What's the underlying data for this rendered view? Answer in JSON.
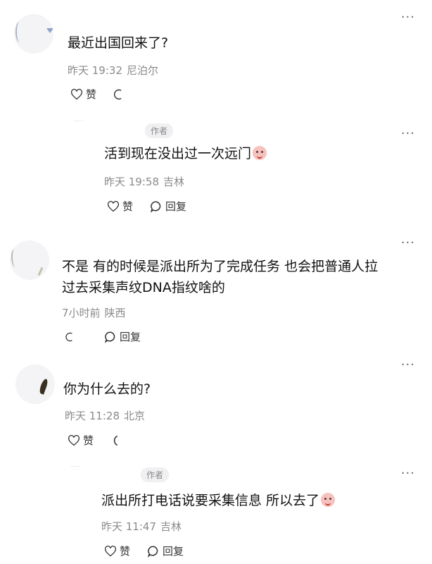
{
  "comments": [
    {
      "text": "最近出国回来了?",
      "time": "昨天 19:32",
      "location": "尼泊尔",
      "like_label": "赞",
      "more": "···",
      "replies": [
        {
          "author_badge": "作者",
          "text": "活到现在没出过一次远门",
          "time": "昨天 19:58",
          "location": "吉林",
          "like_label": "赞",
          "reply_label": "回复",
          "more": "···"
        }
      ]
    },
    {
      "text_line1": "不是 有的时候是派出所为了完成任务 也会把普通人拉",
      "text_line2": "过去采集声纹DNA指纹啥的",
      "time": "7小时前",
      "location": "陕西",
      "reply_label": "回复",
      "more": "···"
    },
    {
      "text": "你为什么去的?",
      "time": "昨天 11:28",
      "location": "北京",
      "like_label": "赞",
      "more": "···",
      "replies": [
        {
          "author_badge": "作者",
          "text": "派出所打电话说要采集信息 所以去了",
          "time": "昨天 11:47",
          "location": "吉林",
          "like_label": "赞",
          "reply_label": "回复",
          "more": "···"
        }
      ]
    }
  ],
  "icons": {
    "like": "heart-outline-icon",
    "reply": "speech-bubble-icon",
    "more": "more-dots-icon",
    "emoji": "crying-face-emoji"
  },
  "colors": {
    "text": "#111111",
    "meta": "#8a8a8a",
    "icon": "#333333",
    "badge_bg": "#f0f0f2"
  }
}
